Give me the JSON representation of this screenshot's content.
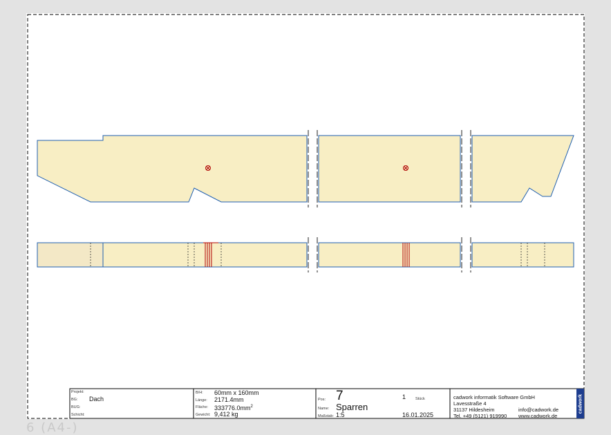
{
  "sheet": {
    "page_label": "6 (A4-)"
  },
  "title_block": {
    "project": {
      "label": "Projekt:",
      "value": ""
    },
    "bg": {
      "label": "BG:",
      "value": "Dach"
    },
    "bug": {
      "label": "BUG:",
      "value": ""
    },
    "layer": {
      "label": "Schicht:",
      "value": ""
    },
    "dims": {
      "label": "B/H:",
      "value": "60mm x 160mm"
    },
    "length": {
      "label": "Länge:",
      "value": "2171.4mm"
    },
    "area": {
      "label": "Fläche:",
      "value": "333776.0mm",
      "unit_sup": "2"
    },
    "weight": {
      "label": "Gewicht:",
      "value": "9,412 kg"
    },
    "pos": {
      "label": "Pos:",
      "value": "7"
    },
    "count": {
      "value": "1",
      "label": "Stück"
    },
    "name": {
      "label": "Name:",
      "value": "Sparren"
    },
    "scale": {
      "label": "Maßstab:",
      "value": "1:5"
    },
    "date": "16.01.2025",
    "company": {
      "name": "cadwork informatik Software GmbH",
      "street": "Lavesstraße 4",
      "city": "31137 Hildesheim",
      "phone": "Tel. +49 (5121) 919990",
      "email": "info@cadwork.de",
      "web": "www.cadwork.de"
    },
    "logo_text": "cadwork"
  },
  "colors": {
    "wood_fill": "#f8eec4",
    "outline": "#1f5fb0",
    "cut_red": "#b00000",
    "frame": "#000000"
  }
}
